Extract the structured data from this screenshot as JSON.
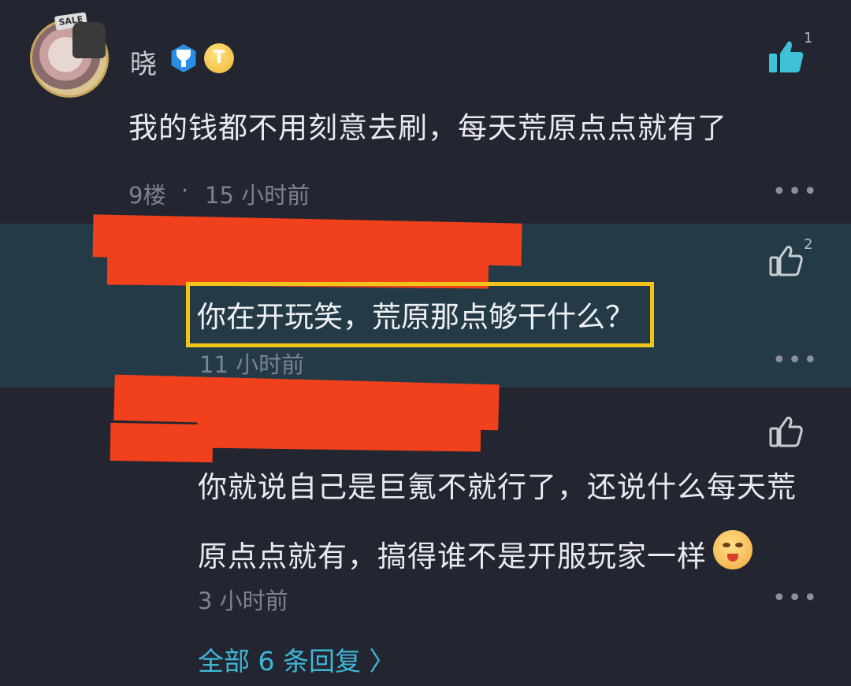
{
  "main_comment": {
    "username": "晓",
    "gold_badge_label": "T",
    "text": "我的钱都不用刻意去刷，每天荒原点点就有了",
    "floor": "9楼",
    "separator": "·",
    "time": "15 小时前",
    "like_count": "1",
    "icons": {
      "like": "thumbs-up-filled-icon",
      "more": "more-dots-icon",
      "badge": "trophy-badge-icon"
    }
  },
  "reply_1": {
    "text": "你在开玩笑，荒原那点够干什么？",
    "time": "11 小时前",
    "like_count": "2"
  },
  "reply_2": {
    "text_line1": "你就说自己是巨氪不就行了，还说什么每天荒",
    "text_line2": "原点点就有，搞得谁不是开服玩家一样",
    "time": "3 小时前"
  },
  "more_label": "•••",
  "all_replies_label": "全部 6 条回复 〉",
  "colors": {
    "background": "#232630",
    "highlight_band": "#243b47",
    "highlight_border": "#f2c31a",
    "redaction": "#f0401c",
    "link": "#3fb7d8",
    "like_active": "#3fc1d9"
  }
}
